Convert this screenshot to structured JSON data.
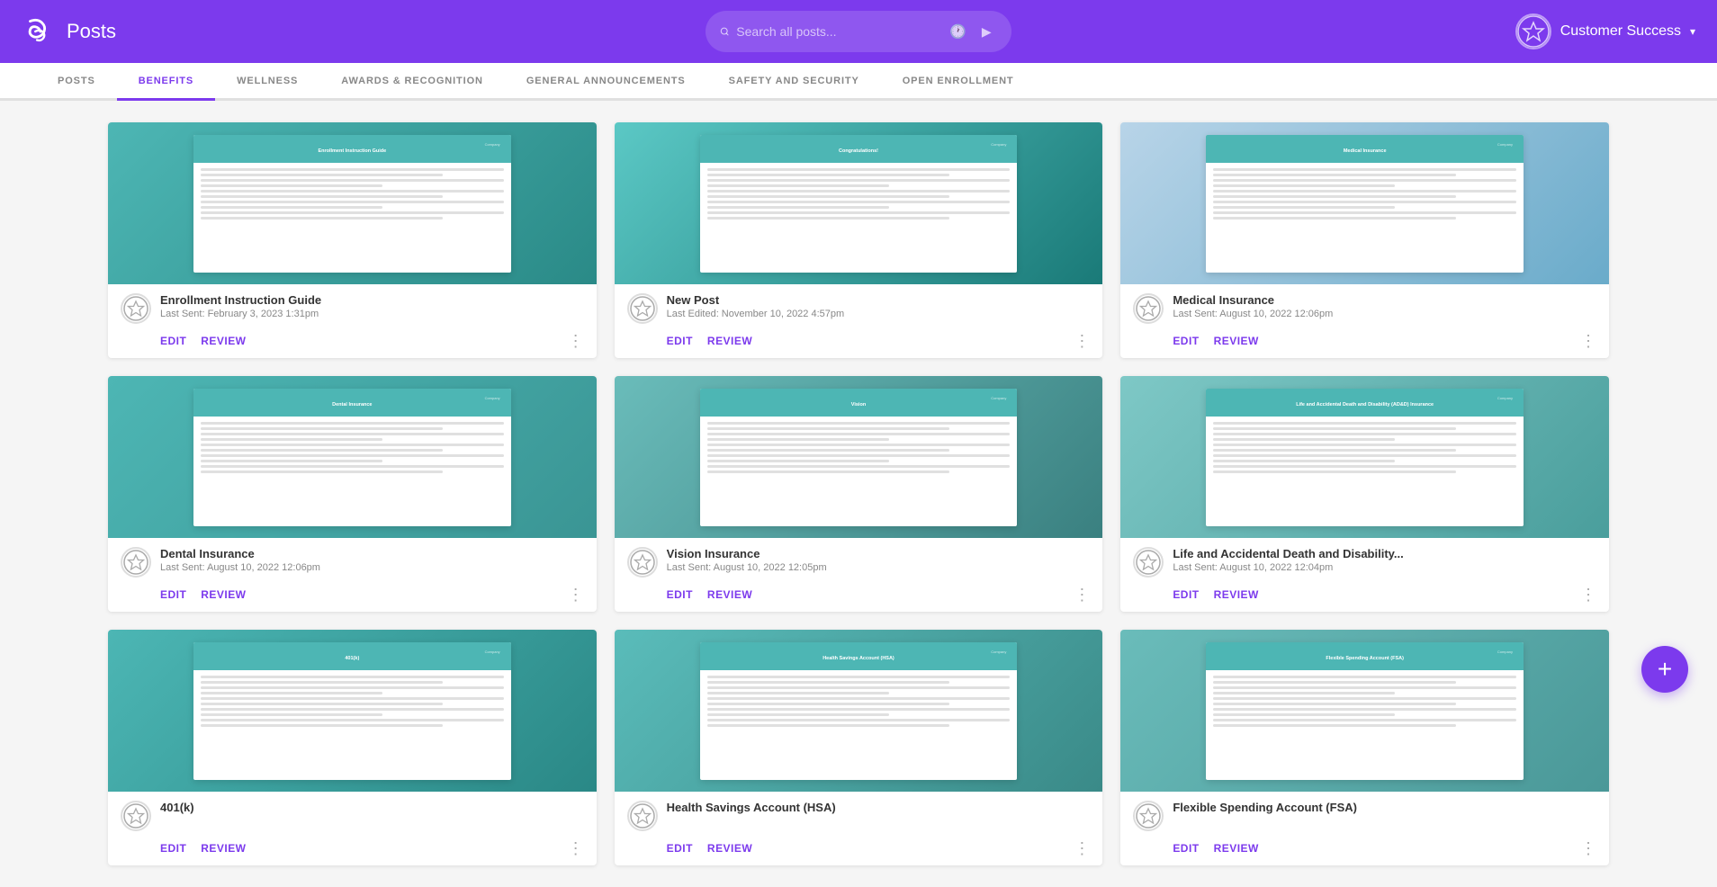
{
  "header": {
    "logo_text": "Posts",
    "search_placeholder": "Search all posts...",
    "user_name": "Customer Success"
  },
  "nav": {
    "items": [
      {
        "label": "POSTS",
        "active": false
      },
      {
        "label": "BENEFITS",
        "active": true
      },
      {
        "label": "WELLNESS",
        "active": false
      },
      {
        "label": "AWARDS & RECOGNITION",
        "active": false
      },
      {
        "label": "GENERAL ANNOUNCEMENTS",
        "active": false
      },
      {
        "label": "SAFETY AND SECURITY",
        "active": false
      },
      {
        "label": "OPEN ENROLLMENT",
        "active": false
      }
    ]
  },
  "posts": [
    {
      "title": "Enrollment Instruction Guide",
      "date": "Last Sent: February 3, 2023 1:31pm",
      "thumb_class": "thumb-enrollment",
      "edit_label": "EDIT",
      "review_label": "REVIEW"
    },
    {
      "title": "New Post",
      "date": "Last Edited: November 10, 2022 4:57pm",
      "thumb_class": "thumb-newpost",
      "edit_label": "EDIT",
      "review_label": "REVIEW"
    },
    {
      "title": "Medical Insurance",
      "date": "Last Sent: August 10, 2022 12:06pm",
      "thumb_class": "thumb-medical",
      "edit_label": "EDIT",
      "review_label": "REVIEW"
    },
    {
      "title": "Dental Insurance",
      "date": "Last Sent: August 10, 2022 12:06pm",
      "thumb_class": "thumb-dental",
      "edit_label": "EDIT",
      "review_label": "REVIEW"
    },
    {
      "title": "Vision Insurance",
      "date": "Last Sent: August 10, 2022 12:05pm",
      "thumb_class": "thumb-vision",
      "edit_label": "EDIT",
      "review_label": "REVIEW"
    },
    {
      "title": "Life and Accidental Death and Disability...",
      "date": "Last Sent: August 10, 2022 12:04pm",
      "thumb_class": "thumb-life",
      "edit_label": "EDIT",
      "review_label": "REVIEW"
    },
    {
      "title": "401(k)",
      "date": "",
      "thumb_class": "thumb-401k",
      "edit_label": "EDIT",
      "review_label": "REVIEW"
    },
    {
      "title": "Health Savings Account (HSA)",
      "date": "",
      "thumb_class": "thumb-hsa",
      "edit_label": "EDIT",
      "review_label": "REVIEW"
    },
    {
      "title": "Flexible Spending Account (FSA)",
      "date": "",
      "thumb_class": "thumb-fsa",
      "edit_label": "EDIT",
      "review_label": "REVIEW"
    }
  ],
  "fab_label": "+",
  "colors": {
    "brand_purple": "#7c3aed"
  }
}
